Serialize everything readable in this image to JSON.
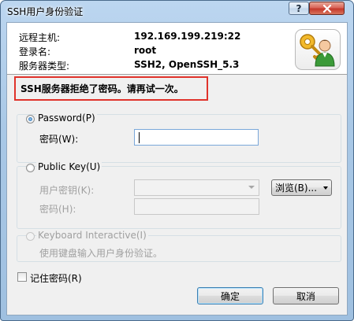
{
  "window": {
    "title": "SSH用户身份验证",
    "help_label": "?"
  },
  "info": {
    "host_label": "远程主机:",
    "host_value": "192.169.199.219:22",
    "login_label": "登录名:",
    "login_value": "root",
    "server_type_label": "服务器类型:",
    "server_type_value": "SSH2, OpenSSH_5.3"
  },
  "error_message": "SSH服务器拒绝了密码。请再试一次。",
  "password_group": {
    "option_label": "Password(P)",
    "checked": true,
    "password_label": "密码(W):",
    "password_value": ""
  },
  "public_key_group": {
    "option_label": "Public Key(U)",
    "checked": false,
    "user_key_label": "用户密钥(K):",
    "user_key_value": "",
    "browse_label": "浏览(B)...",
    "passphrase_label": "密码(H):",
    "passphrase_value": ""
  },
  "keyboard_group": {
    "option_label": "Keyboard Interactive(I)",
    "checked": false,
    "description": "使用键盘输入用户身份验证。"
  },
  "remember_password": {
    "label": "记住密码(R)",
    "checked": false
  },
  "buttons": {
    "ok_label": "确定",
    "cancel_label": "取消"
  },
  "colors": {
    "error_border": "#e0332b",
    "close_button": "#c4382b",
    "input_focus_border": "#7aa7d9"
  },
  "icons": {
    "app": "key-user-icon",
    "close": "close-icon"
  }
}
